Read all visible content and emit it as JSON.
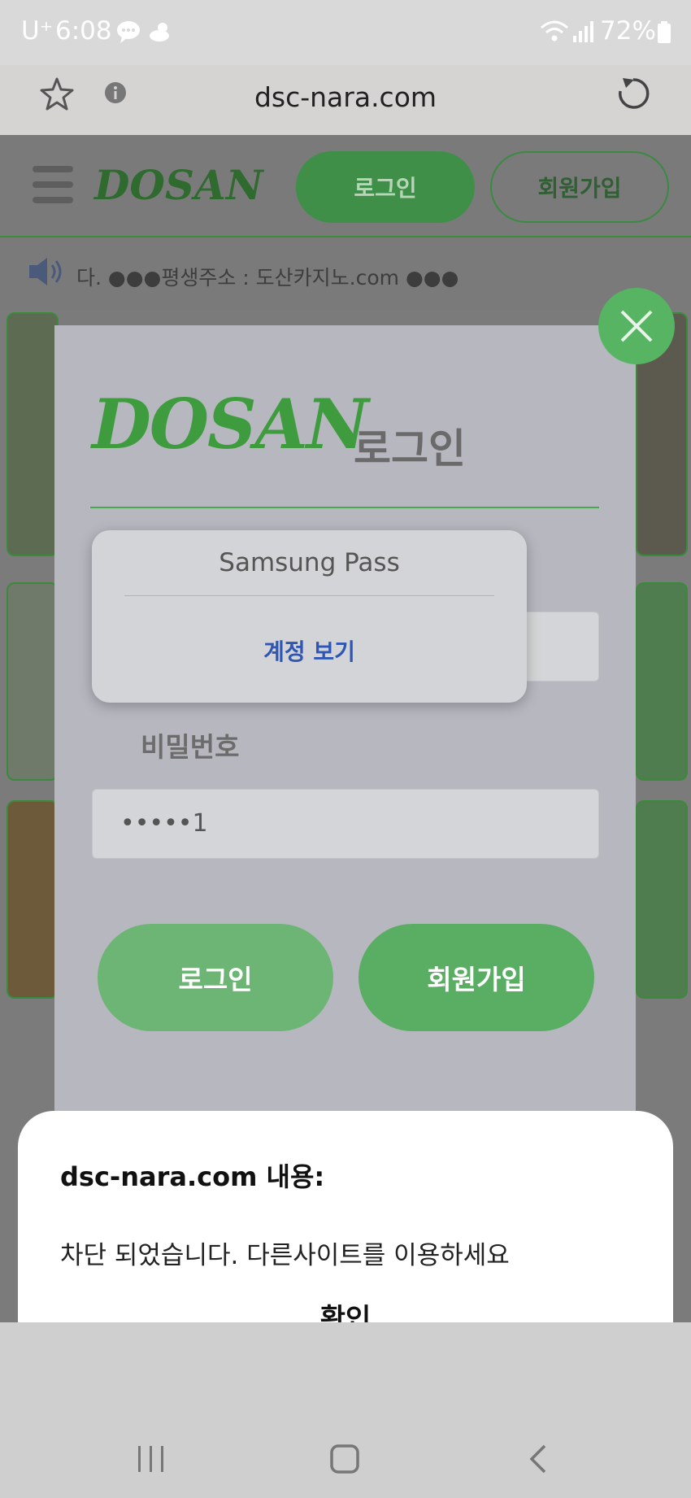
{
  "status_bar": {
    "carrier": "U⁺",
    "time": "6:08",
    "battery": "72%",
    "icons": [
      "chat-bubble-icon",
      "weather-icon",
      "wifi-icon",
      "signal-icon",
      "battery-icon"
    ]
  },
  "browser": {
    "url": "dsc-nara.com",
    "icons": [
      "star-icon",
      "info-icon",
      "reload-icon"
    ]
  },
  "site_header": {
    "logo": "DOSAN",
    "login_label": "로그인",
    "signup_label": "회원가입"
  },
  "notice": {
    "text": "다. ●●●평생주소 : 도산카지노.com ●●●"
  },
  "modal": {
    "logo": "DOSAN",
    "title": "로그인",
    "password_label": "비밀번호",
    "password_value": "•••••1",
    "login_button": "로그인",
    "signup_button": "회원가입"
  },
  "samsung_pass": {
    "title": "Samsung Pass",
    "action": "계정 보기"
  },
  "dialog": {
    "title": "dsc-nara.com 내용:",
    "message": "차단 되었습니다. 다른사이트를 이용하세요",
    "confirm": "확인"
  },
  "colors": {
    "brand_green": "#57b463",
    "link_blue": "#2f56b5"
  }
}
